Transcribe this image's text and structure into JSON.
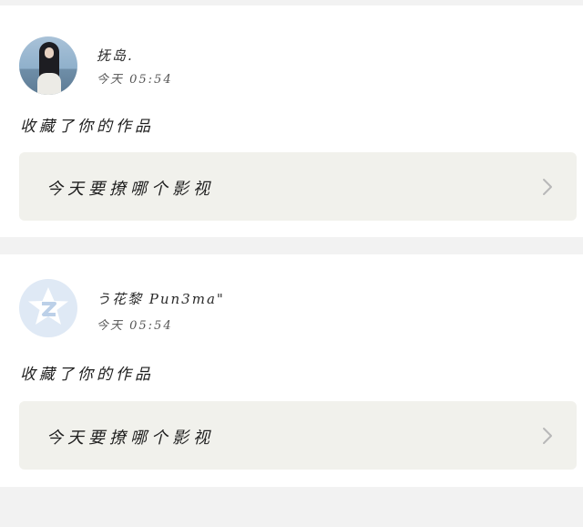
{
  "feed": [
    {
      "user_name": "抚岛.",
      "time": "今天 05:54",
      "action": "收藏了你的作品",
      "work_title": "今天要撩哪个影视",
      "avatar_icon": "user-photo-avatar"
    },
    {
      "user_name": "う花黎 Pun3ma\"",
      "time": "今天 05:54",
      "action": "收藏了你的作品",
      "work_title": "今天要撩哪个影视",
      "avatar_icon": "qq-default-avatar"
    }
  ],
  "colors": {
    "page_bg": "#f2f2f2",
    "card_bg": "#ffffff",
    "work_bg": "#f1f1ec",
    "chevron": "#b8b8b8",
    "qq_avatar_bg": "#dfe9f5"
  }
}
